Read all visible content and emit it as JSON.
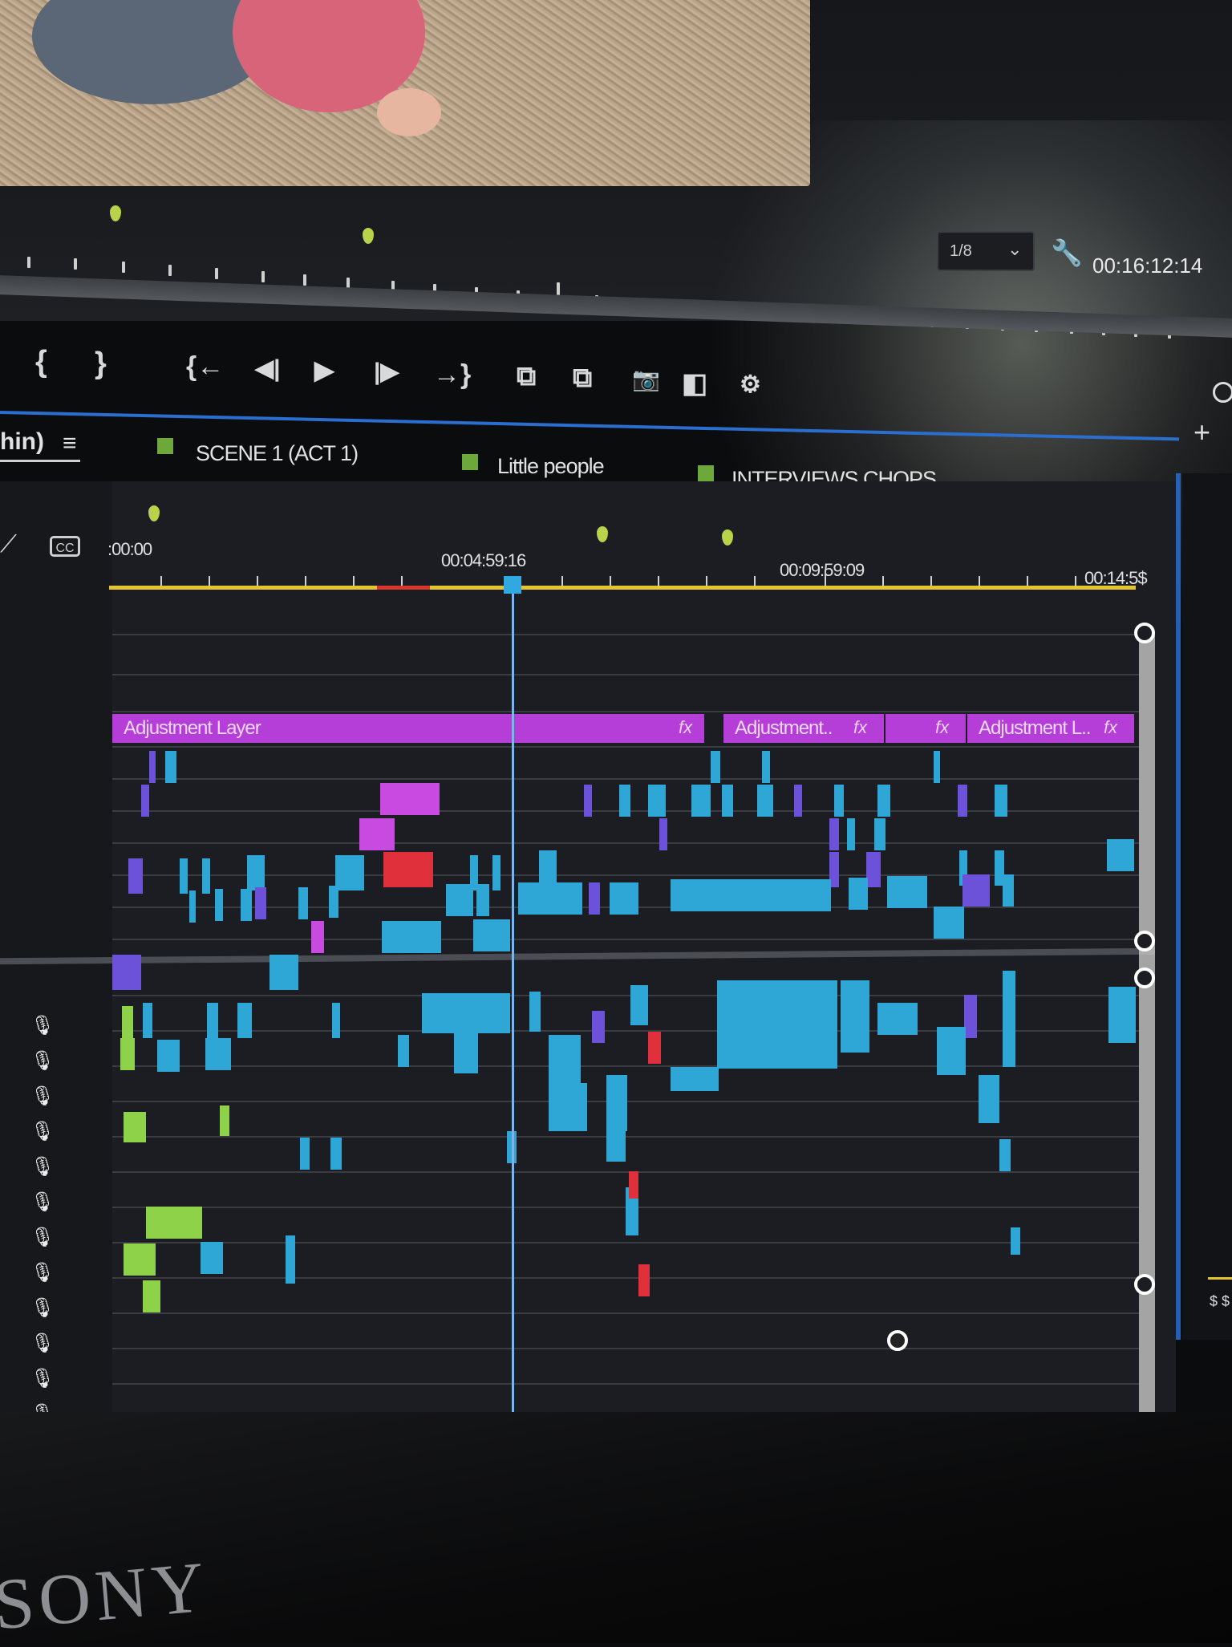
{
  "monitor": {
    "scale_value": "1/8",
    "timecode": "00:16:12:14"
  },
  "panel": {
    "label": "hin)",
    "menu_icon": "≡"
  },
  "tabs": [
    {
      "label": "SCENE 1 (ACT 1)"
    },
    {
      "label": "Little people"
    },
    {
      "label": "INTERVIEWS CHOPS"
    }
  ],
  "ruler": {
    "t0": ":00:00",
    "t1": "00:04:59:16",
    "t2": "00:09:59:09",
    "t3": "00:14:5$"
  },
  "clips": {
    "adj1": "Adjustment Layer",
    "adj2": "Adjustment..",
    "adj3": "Adjustment L..",
    "fx": "fx"
  },
  "controls": {
    "mark_in": "{",
    "mark_out": "}",
    "go_to_in": "{←",
    "step_back": "◀|",
    "play": "▶",
    "step_forward": "|▶",
    "go_to_out": "→}",
    "insert": "⧉",
    "overwrite": "⧉",
    "export_frame": "📷",
    "compare": "◧",
    "settings": "⚙"
  },
  "brand": "SONY",
  "right_panel_text": "$ $",
  "colors": {
    "accent_blue": "#2a6fd0",
    "clip_cyan": "#2ea6d6",
    "clip_purple": "#6b52d8",
    "adjustment_magenta": "#b53dd8",
    "audio_green": "#8ed24a",
    "work_area_yellow": "#e5c331"
  }
}
